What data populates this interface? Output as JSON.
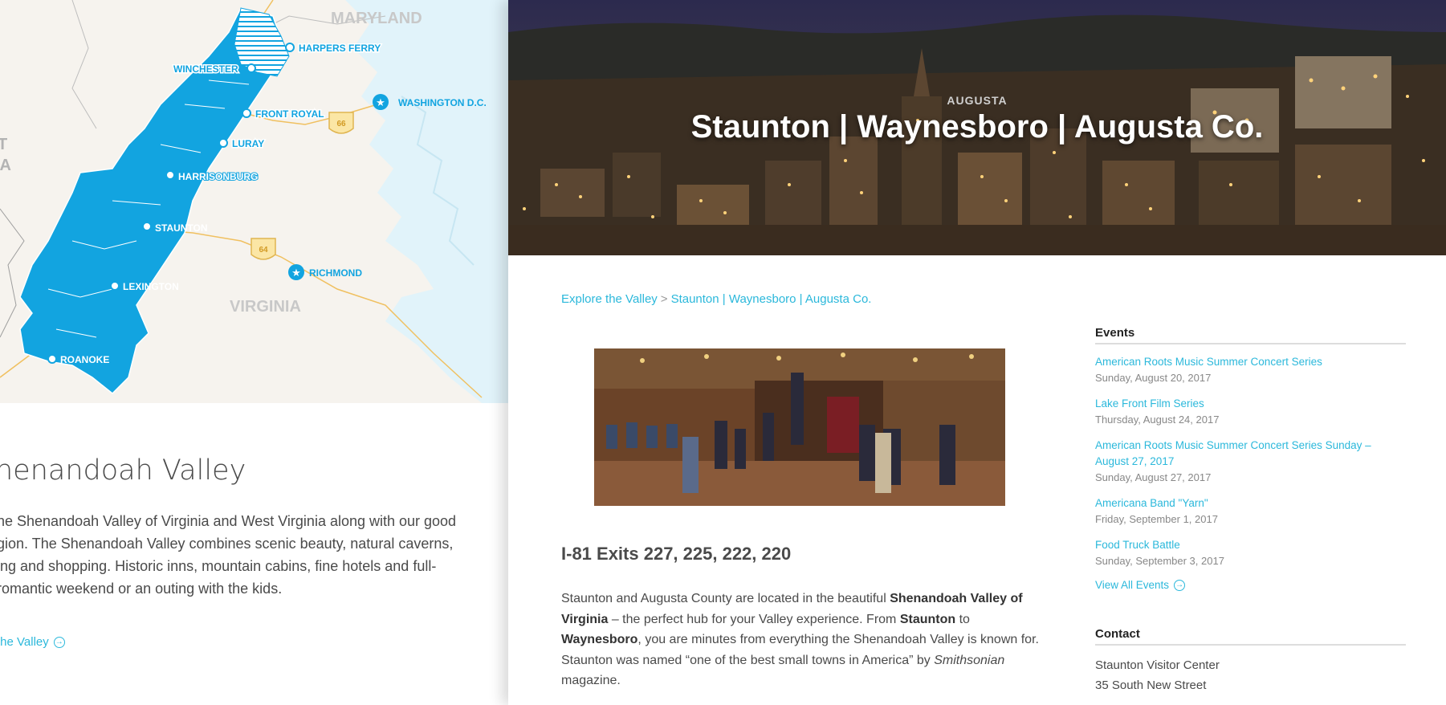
{
  "map": {
    "labels": {
      "maryland": "MARYLAND",
      "virginia": "VIRGINIA",
      "edge_t": "T",
      "edge_ia": "IA",
      "harpers_ferry": "HARPERS FERRY",
      "winchester": "WINCHESTER",
      "front_royal": "FRONT ROYAL",
      "washington": "WASHINGTON D.C.",
      "luray": "LURAY",
      "harrisonburg": "HARRISONBURG",
      "staunton": "STAUNTON",
      "richmond": "RICHMOND",
      "lexington": "LEXINGTON",
      "roanoke": "ROANOKE",
      "i66": "66",
      "i64": "64"
    },
    "colors": {
      "region": "#12a4e0",
      "water": "#e1f3fa",
      "land": "#f6f3ee",
      "highway": "#f0c060"
    }
  },
  "left": {
    "title": "henandoah Valley",
    "body": [
      "he Shenandoah Valley of Virginia and West Virginia along with our good",
      "gion. The Shenandoah Valley combines scenic beauty, natural caverns,",
      "ing and shopping. Historic inns, mountain cabins, fine hotels and full-",
      "romantic weekend or an outing with the kids."
    ],
    "link": "the Valley"
  },
  "hero": {
    "kicker": "AUGUSTA",
    "title": "Staunton | Waynesboro | Augusta Co."
  },
  "breadcrumb": {
    "home": "Explore the Valley",
    "separator": ">",
    "current": "Staunton | Waynesboro | Augusta Co."
  },
  "main": {
    "exits": "I-81 Exits 227, 225, 222, 220",
    "desc": {
      "p1": "Staunton and Augusta County are located in the beautiful ",
      "b1": "Shenandoah Valley of Virginia",
      "p2": " – the perfect hub for your Valley experience. From ",
      "b2": "Staunton",
      "p3": " to ",
      "b3": "Waynesboro",
      "p4": ", you are minutes from everything the Shenandoah Valley is known for. Staunton was named “one of the best small towns in America” by ",
      "i1": "Smithsonian",
      "p5": " magazine."
    }
  },
  "sidebar": {
    "events_heading": "Events",
    "events": [
      {
        "title": "American Roots Music Summer Concert Series",
        "date": "Sunday, August 20, 2017"
      },
      {
        "title": "Lake Front Film Series",
        "date": "Thursday, August 24, 2017"
      },
      {
        "title": "American Roots Music Summer Concert Series Sunday – August 27, 2017",
        "date": "Sunday, August 27, 2017"
      },
      {
        "title": "Americana Band \"Yarn\"",
        "date": "Friday, September 1, 2017"
      },
      {
        "title": "Food Truck Battle",
        "date": "Sunday, September 3, 2017"
      }
    ],
    "view_all": "View All Events",
    "contact_heading": "Contact",
    "contact_name": "Staunton Visitor Center",
    "contact_address": "35 South New Street"
  },
  "colors": {
    "accent": "#2bb8db",
    "text": "#4a4a4a"
  }
}
